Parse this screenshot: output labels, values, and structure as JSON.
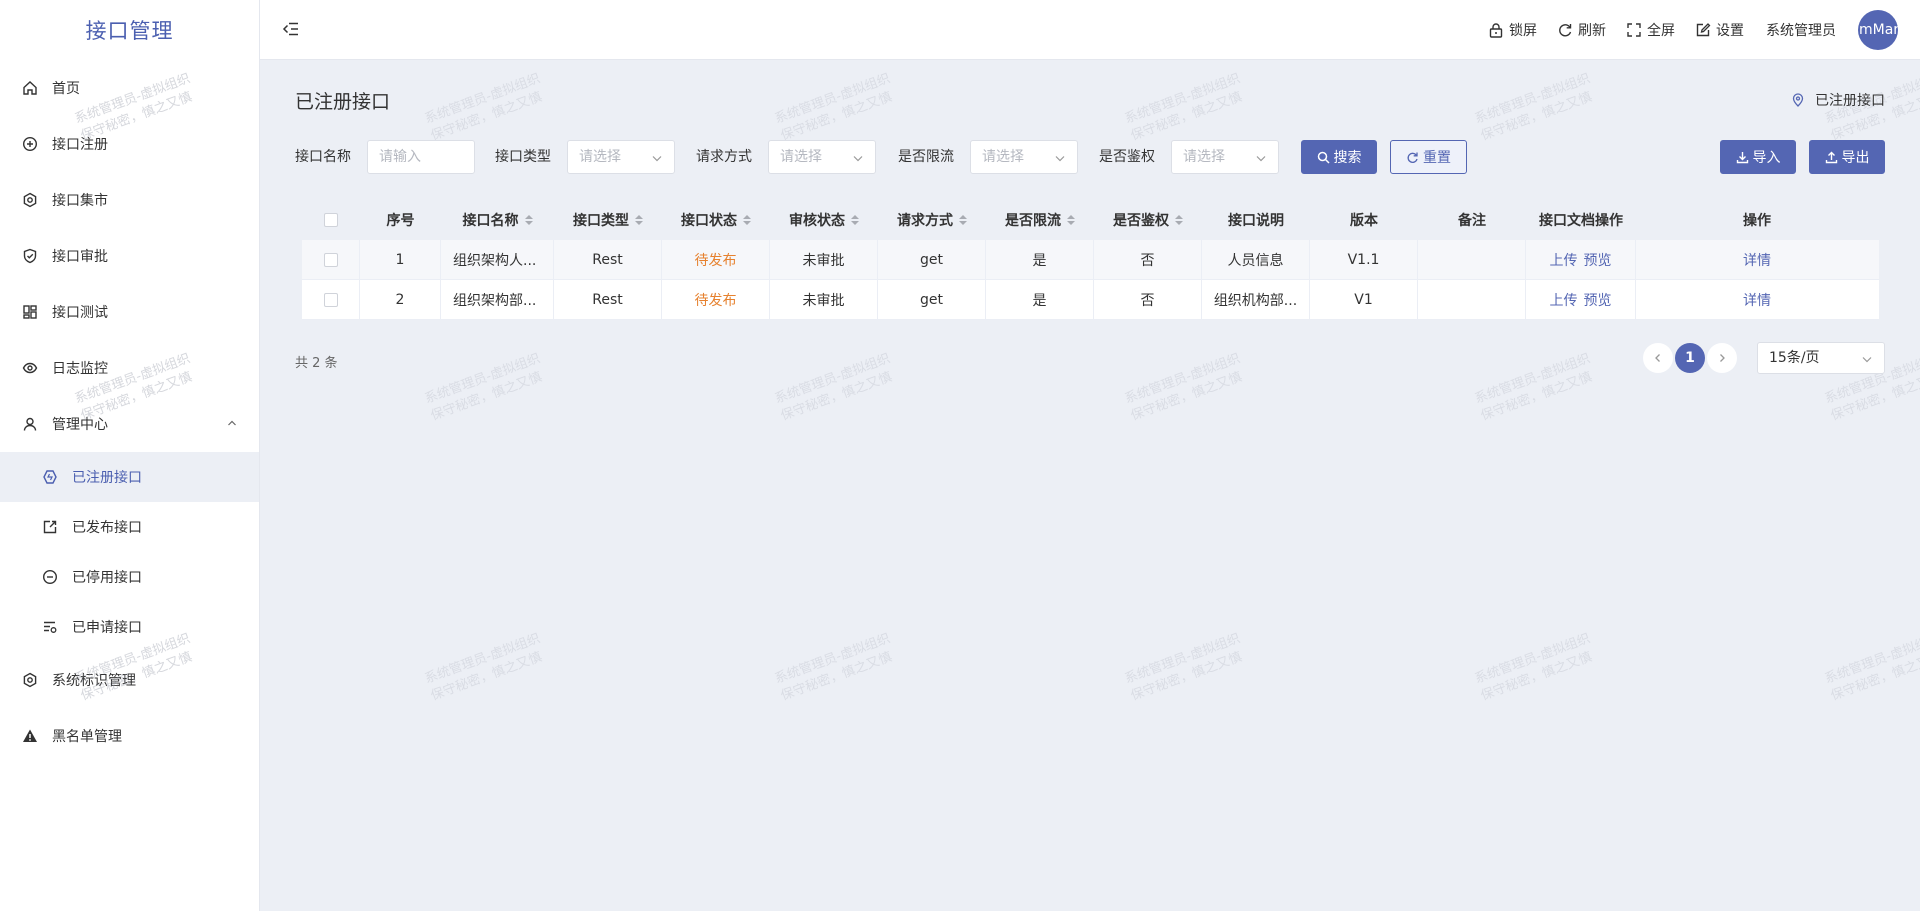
{
  "app": {
    "title": "接口管理"
  },
  "sidebar": {
    "items": [
      {
        "label": "首页",
        "icon": "home-icon"
      },
      {
        "label": "接口注册",
        "icon": "plus-circle-icon"
      },
      {
        "label": "接口集市",
        "icon": "gear-icon"
      },
      {
        "label": "接口审批",
        "icon": "shield-check-icon"
      },
      {
        "label": "接口测试",
        "icon": "dashboard-icon"
      },
      {
        "label": "日志监控",
        "icon": "eye-icon"
      },
      {
        "label": "管理中心",
        "icon": "user-icon"
      }
    ],
    "subitems": [
      {
        "label": "已注册接口",
        "icon": "hexagon-icon"
      },
      {
        "label": "已发布接口",
        "icon": "share-icon"
      },
      {
        "label": "已停用接口",
        "icon": "minus-circle-icon"
      },
      {
        "label": "已申请接口",
        "icon": "list-settings-icon"
      }
    ],
    "items_after": [
      {
        "label": "系统标识管理",
        "icon": "gear-icon"
      },
      {
        "label": "黑名单管理",
        "icon": "warning-icon"
      }
    ]
  },
  "header": {
    "lock": "锁屏",
    "refresh": "刷新",
    "fullscreen": "全屏",
    "settings": "设置",
    "user": "系统管理员",
    "avatar_text": "mMar"
  },
  "page": {
    "title": "已注册接口",
    "breadcrumb": "已注册接口"
  },
  "filter": {
    "name_label": "接口名称",
    "name_placeholder": "请输入",
    "type_label": "接口类型",
    "method_label": "请求方式",
    "limit_label": "是否限流",
    "auth_label": "是否鉴权",
    "select_placeholder": "请选择",
    "search": "搜索",
    "reset": "重置",
    "import": "导入",
    "export": "导出"
  },
  "table": {
    "columns": [
      "序号",
      "接口名称",
      "接口类型",
      "接口状态",
      "审核状态",
      "请求方式",
      "是否限流",
      "是否鉴权",
      "接口说明",
      "版本",
      "备注",
      "接口文档操作",
      "操作"
    ],
    "rows": [
      {
        "index": "1",
        "name": "组织架构人...",
        "type": "Rest",
        "status": "待发布",
        "review": "未审批",
        "method": "get",
        "limit": "是",
        "auth": "否",
        "desc": "人员信息",
        "version": "V1.1",
        "remark": "",
        "upload": "上传",
        "preview": "预览",
        "detail": "详情"
      },
      {
        "index": "2",
        "name": "组织架构部...",
        "type": "Rest",
        "status": "待发布",
        "review": "未审批",
        "method": "get",
        "limit": "是",
        "auth": "否",
        "desc": "组织机构部...",
        "version": "V1",
        "remark": "",
        "upload": "上传",
        "preview": "预览",
        "detail": "详情"
      }
    ]
  },
  "pagination": {
    "total": "共 2 条",
    "current": "1",
    "page_size": "15条/页"
  },
  "watermark": {
    "line1": "系统管理员-虚拟组织",
    "line2": "保守秘密，慎之又慎"
  },
  "colors": {
    "accent": "#5466b3",
    "status_pending": "#e6812e",
    "background": "#eceff5"
  }
}
